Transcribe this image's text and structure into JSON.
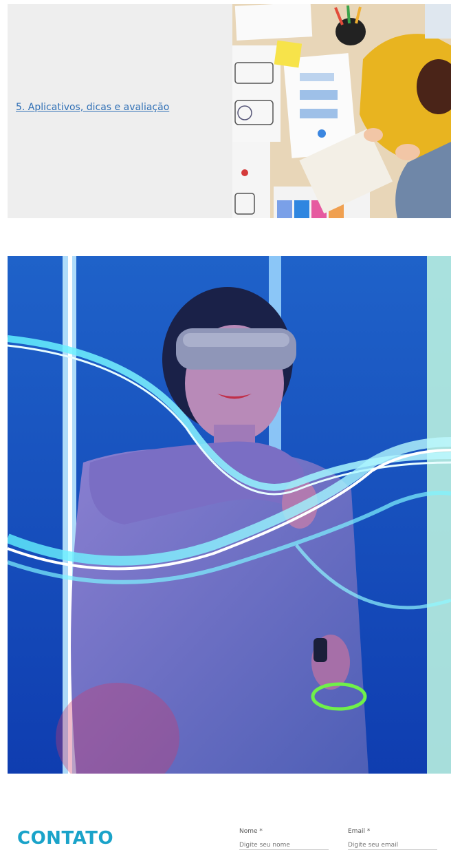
{
  "card": {
    "link_text": "5. Aplicativos, dicas e avaliação"
  },
  "contact": {
    "title": "CONTATO",
    "name_label": "Nome *",
    "name_placeholder": "Digite seu nome",
    "email_label": "Email *",
    "email_placeholder": "Digite seu email"
  },
  "colors": {
    "link": "#2f6fb5",
    "contact_title": "#1aa3c9",
    "card_bg": "#eeeeee",
    "hero_bg": "#1c4ec0"
  }
}
